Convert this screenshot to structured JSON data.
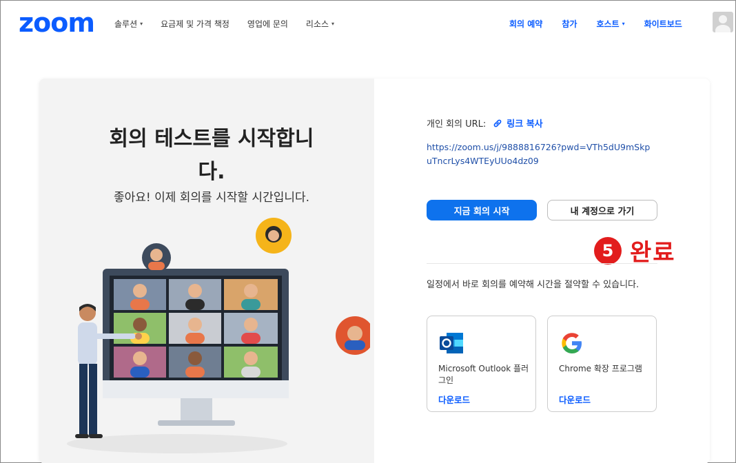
{
  "nav": {
    "logo": "zoom",
    "left_items": [
      {
        "label": "솔루션",
        "has_caret": true
      },
      {
        "label": "요금제 및 가격 책정",
        "has_caret": false
      },
      {
        "label": "영업에 문의",
        "has_caret": false
      },
      {
        "label": "리소스",
        "has_caret": true
      }
    ],
    "right_items": [
      {
        "label": "회의 예약",
        "has_caret": false
      },
      {
        "label": "참가",
        "has_caret": false
      },
      {
        "label": "호스트",
        "has_caret": true
      },
      {
        "label": "화이트보드",
        "has_caret": false
      }
    ],
    "caret_symbol": "▾",
    "avatar_icon": "user-avatar-icon"
  },
  "left": {
    "title_line1": "회의 테스트를 시작합니",
    "title_line2": "다.",
    "subtitle": "좋아요! 이제 회의를 시작할 시간입니다."
  },
  "right": {
    "url_label": "개인 회의 URL:",
    "copy_link_label": "링크 복사",
    "url_value": "https://zoom.us/j/9888816726?pwd=VTh5dU9mSkpuTncrLys4WTEyUUo4dz09",
    "start_button": "지금 회의 시작",
    "account_button": "내 계정으로 가기",
    "step_number": "5",
    "step_label": "완료",
    "schedule_text": "일정에서 바로 회의를 예약해 시간을 절약할 수 있습니다.",
    "plugins": [
      {
        "name": "Microsoft Outlook 플러그인",
        "download": "다운로드",
        "icon": "outlook-icon"
      },
      {
        "name": "Chrome 확장 프로그램",
        "download": "다운로드",
        "icon": "google-icon"
      }
    ]
  },
  "colors": {
    "brand_blue": "#0b5cff",
    "button_blue": "#0e72ed",
    "step_red": "#e21d1d",
    "left_panel_bg": "#f3f3f3"
  }
}
